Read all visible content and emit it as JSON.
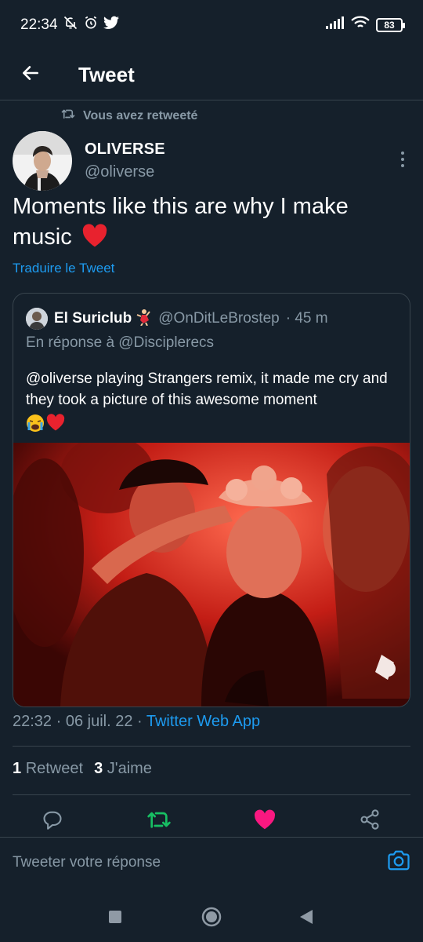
{
  "status": {
    "time": "22:34",
    "battery": "83"
  },
  "header": {
    "title": "Tweet"
  },
  "retweet": {
    "notice": "Vous avez retweeté"
  },
  "author": {
    "name": "OLIVERSE",
    "handle": "@oliverse"
  },
  "tweet": {
    "text": "Moments like this are why I make music",
    "translate": "Traduire le Tweet"
  },
  "quote": {
    "name": "El Suriclub",
    "handle": "@OnDitLeBrostep",
    "age": "· 45 m",
    "reply_to": "En réponse à @Disciplerecs",
    "text": "@oliverse playing Strangers remix, it made me cry and they took a picture of this awesome moment"
  },
  "meta": {
    "time": "22:32 · 06 juil. 22 · ",
    "source": "Twitter Web App"
  },
  "stats": {
    "retweets": "1",
    "retweets_label": "Retweet",
    "likes": "3",
    "likes_label": "J'aime"
  },
  "reply": {
    "placeholder": "Tweeter votre réponse"
  },
  "colors": {
    "background": "#15202b",
    "accent": "#1d9bf0",
    "retweet_active": "#17bf63",
    "like_active": "#f91880",
    "muted": "#8899a6",
    "border": "#38444d"
  },
  "icons": [
    "mute-icon",
    "alarm-icon",
    "twitter-bird-icon",
    "signal-icon",
    "wifi-icon",
    "battery-icon",
    "back-arrow-icon",
    "retweet-icon",
    "more-icon",
    "reply-icon",
    "like-icon",
    "share-icon",
    "camera-icon",
    "recents-icon",
    "home-icon",
    "back-nav-icon"
  ]
}
